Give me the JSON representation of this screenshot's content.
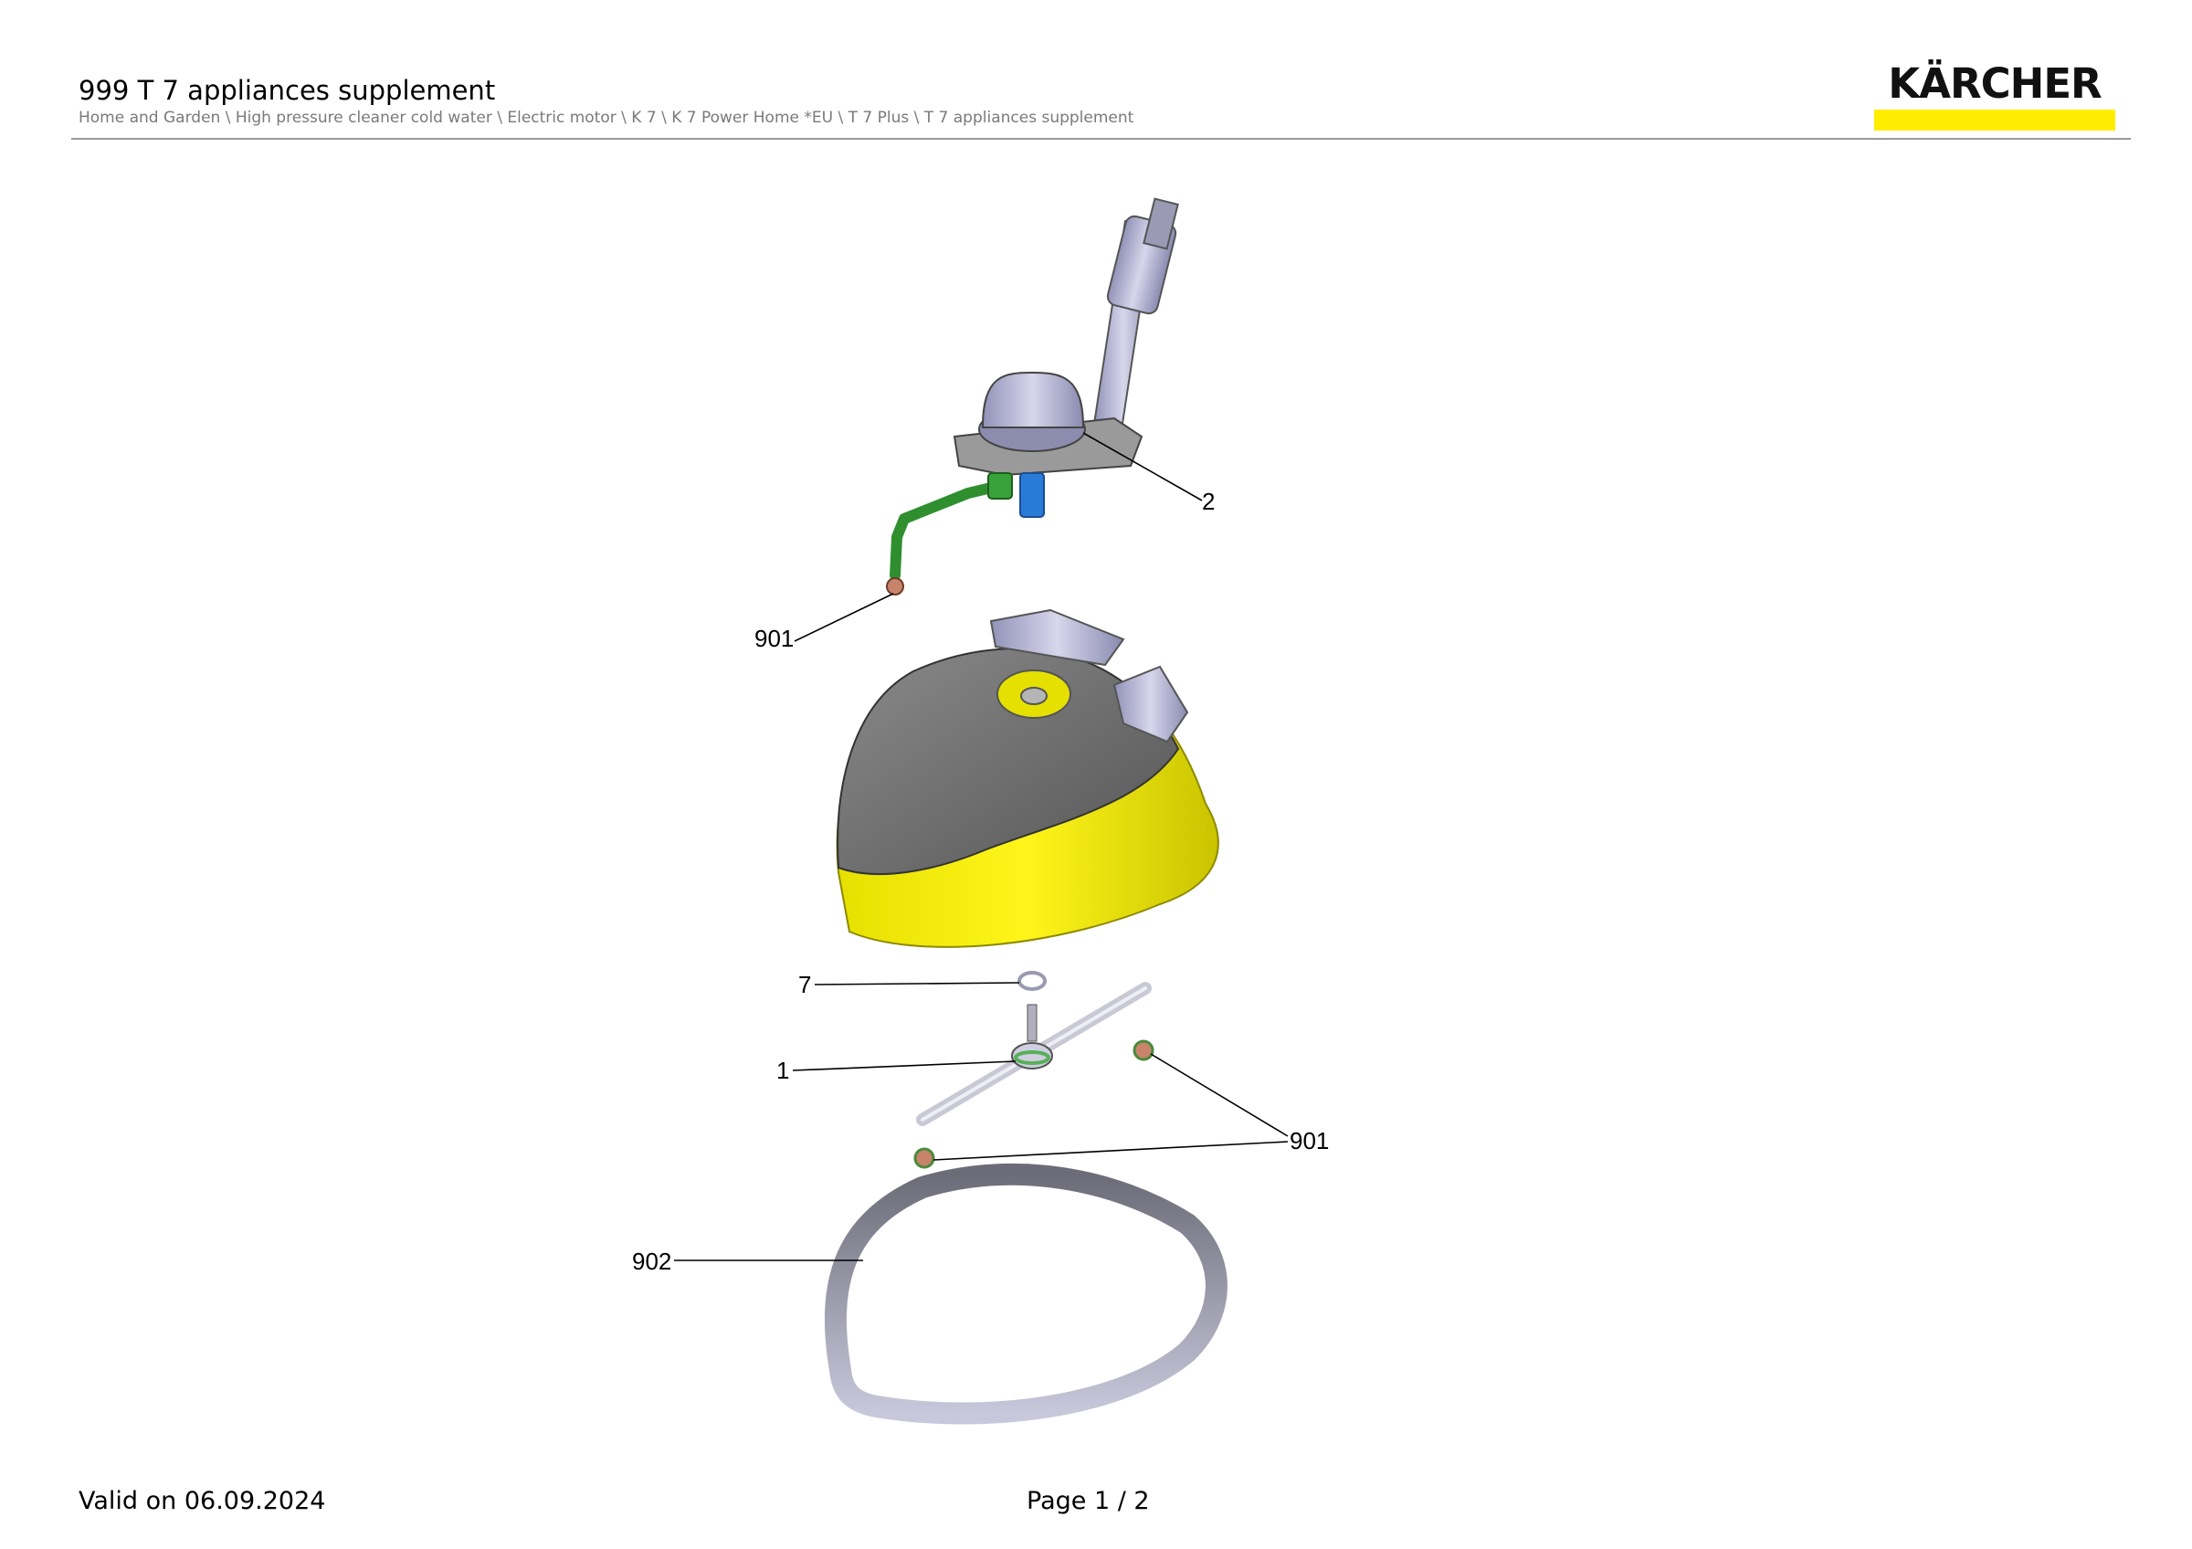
{
  "header": {
    "title": "999 T 7 appliances supplement",
    "breadcrumb": "Home and Garden \\ High pressure cleaner cold water \\ Electric motor \\ K 7 \\ K 7 Power Home *EU \\ T 7 Plus \\ T 7 appliances supplement",
    "logo_text": "KÄRCHER"
  },
  "colors": {
    "brand_yellow": "#ffed00",
    "housing_grey": "#707070",
    "part_lavender": "#b6b6d2",
    "hose_green": "#2f8f2f",
    "nozzle_blue": "#2a7ad8"
  },
  "callouts": [
    {
      "id": "2",
      "label": "2"
    },
    {
      "id": "901a",
      "label": "901"
    },
    {
      "id": "7",
      "label": "7"
    },
    {
      "id": "1",
      "label": "1"
    },
    {
      "id": "901b",
      "label": "901"
    },
    {
      "id": "902",
      "label": "902"
    }
  ],
  "footer": {
    "valid": "Valid on 06.09.2024",
    "page": "Page 1 / 2"
  }
}
